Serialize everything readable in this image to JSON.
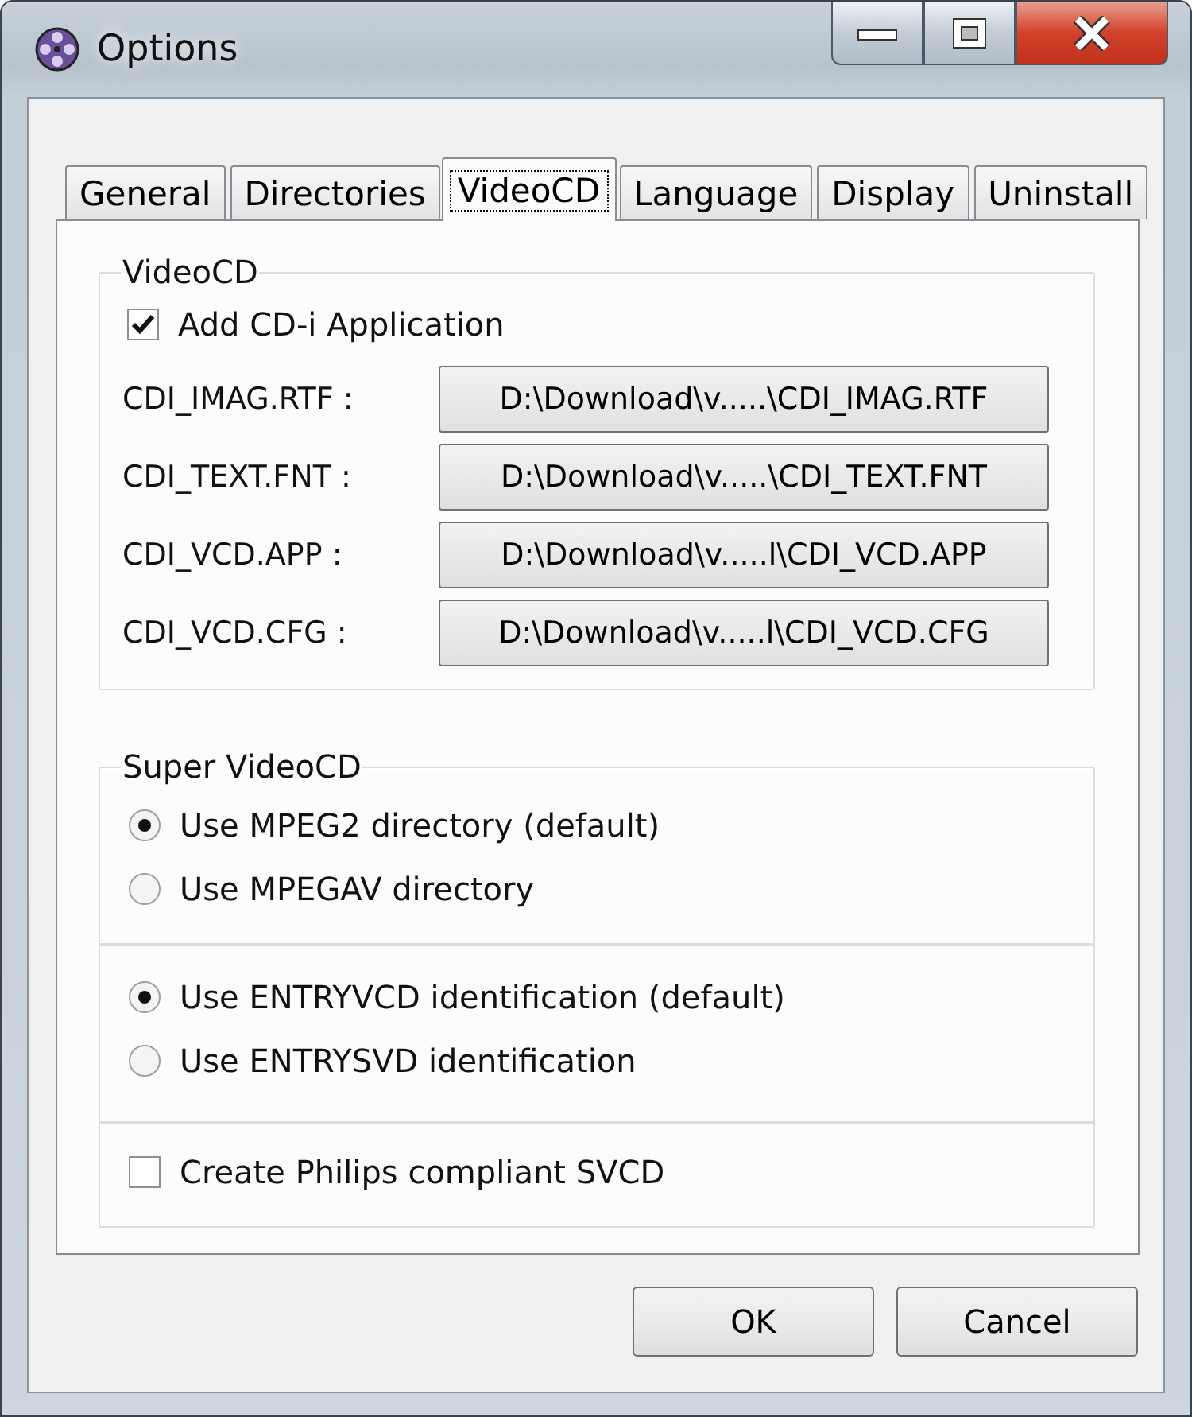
{
  "window": {
    "title": "Options"
  },
  "tabs": [
    {
      "label": "General",
      "selected": false
    },
    {
      "label": "Directories",
      "selected": false
    },
    {
      "label": "VideoCD",
      "selected": true
    },
    {
      "label": "Language",
      "selected": false
    },
    {
      "label": "Display",
      "selected": false
    },
    {
      "label": "Uninstall",
      "selected": false
    }
  ],
  "videocd_group": {
    "title": "VideoCD",
    "add_cdi": {
      "label": "Add CD-i Application",
      "checked": true
    },
    "files": [
      {
        "label": "CDI_IMAG.RTF :",
        "path": "D:\\Download\\v.....\\CDI_IMAG.RTF"
      },
      {
        "label": "CDI_TEXT.FNT :",
        "path": "D:\\Download\\v.....\\CDI_TEXT.FNT"
      },
      {
        "label": "CDI_VCD.APP :",
        "path": "D:\\Download\\v.....l\\CDI_VCD.APP"
      },
      {
        "label": "CDI_VCD.CFG :",
        "path": "D:\\Download\\v.....l\\CDI_VCD.CFG"
      }
    ]
  },
  "super_group": {
    "title": "Super VideoCD",
    "sections": [
      {
        "kind": "radio",
        "options": [
          {
            "label": "Use MPEG2 directory (default)",
            "selected": true
          },
          {
            "label": "Use MPEGAV directory",
            "selected": false
          }
        ]
      },
      {
        "kind": "radio",
        "options": [
          {
            "label": "Use ENTRYVCD identification (default)",
            "selected": true
          },
          {
            "label": "Use ENTRYSVD identification",
            "selected": false
          }
        ]
      },
      {
        "kind": "checkbox",
        "options": [
          {
            "label": "Create Philips compliant SVCD",
            "checked": false
          }
        ]
      }
    ]
  },
  "buttons": [
    "OK",
    "Cancel"
  ]
}
